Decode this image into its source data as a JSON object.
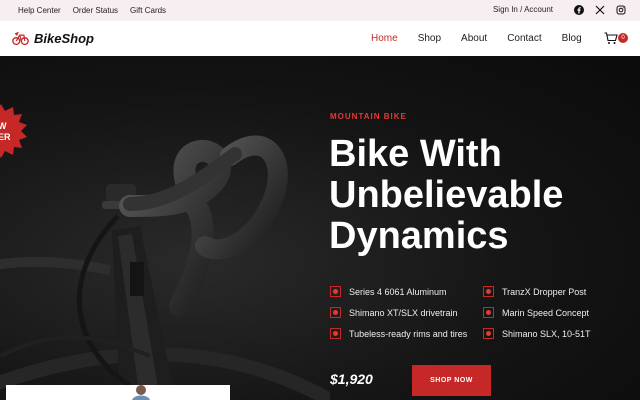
{
  "topbar": {
    "links": [
      "Help Center",
      "Order Status",
      "Gift Cards"
    ],
    "signin": "Sign In / Account",
    "social_icons": [
      "facebook-icon",
      "x-icon",
      "instagram-icon"
    ]
  },
  "brand": {
    "name": "BikeShop",
    "logo_icon": "bike-logo-icon"
  },
  "nav": {
    "items": [
      "Home",
      "Shop",
      "About",
      "Contact",
      "Blog"
    ],
    "active": "Home",
    "cart_count": "0"
  },
  "hero": {
    "badge_text": [
      "W",
      "ER"
    ],
    "eyebrow": "MOUNTAIN BIKE",
    "headline": [
      "Bike With",
      "Unbelievable",
      "Dynamics"
    ],
    "features_left": [
      "Series 4 6061 Aluminum",
      "Shimano XT/SLX drivetrain",
      "Tubeless-ready rims and tires"
    ],
    "features_right": [
      "TranzX Dropper Post",
      "Marin Speed Concept",
      "Shimano SLX, 10-51T"
    ],
    "price": "$1,920",
    "cta": "SHOP NOW"
  },
  "colors": {
    "accent": "#c62828",
    "hero_bg": "#111111",
    "topbar_bg": "#f7eef1"
  }
}
